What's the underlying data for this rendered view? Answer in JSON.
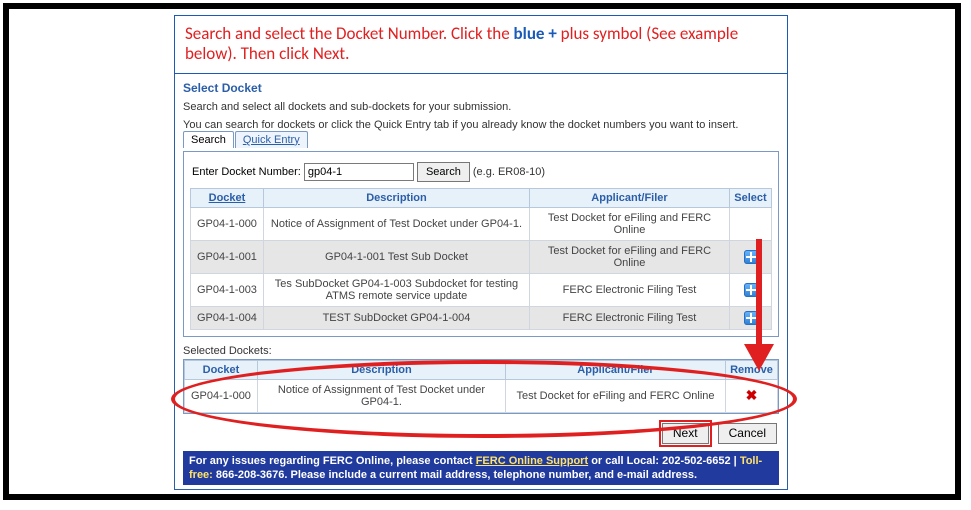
{
  "instruction": {
    "pre": "Search and select the Docket Number.  Click the ",
    "blue_text": "blue +",
    "post": " plus symbol (See example below). Then click Next."
  },
  "legend": "Select Docket",
  "desc": "Search and select all dockets and sub-dockets for your submission.",
  "desc2": "You can search for dockets or click the Quick Entry tab if you already know the docket numbers you want to insert.",
  "tabs": {
    "search": "Search",
    "quick": "Quick Entry"
  },
  "entry": {
    "label": "Enter Docket Number:",
    "value": "gp04-1",
    "search_btn": "Search",
    "eg": "(e.g. ER08-10)"
  },
  "results": {
    "headers": {
      "docket": "Docket",
      "description": "Description",
      "applicant": "Applicant/Filer",
      "select": "Select"
    },
    "rows": [
      {
        "docket": "GP04-1-000",
        "desc": "Notice of Assignment of Test Docket under GP04-1.",
        "applicant": "Test Docket for eFiling and FERC Online",
        "selectable": false
      },
      {
        "docket": "GP04-1-001",
        "desc": "GP04-1-001 Test Sub Docket",
        "applicant": "Test Docket for eFiling and FERC Online",
        "selectable": true
      },
      {
        "docket": "GP04-1-003",
        "desc": "Tes SubDocket GP04-1-003 Subdocket for testing ATMS remote service update",
        "applicant": "FERC Electronic Filing Test",
        "selectable": true
      },
      {
        "docket": "GP04-1-004",
        "desc": "TEST SubDocket GP04-1-004",
        "applicant": "FERC Electronic Filing Test",
        "selectable": true
      }
    ]
  },
  "selected_label": "Selected Dockets:",
  "selected": {
    "headers": {
      "docket": "Docket",
      "description": "Description",
      "applicant": "Applicant/Filer",
      "remove": "Remove"
    },
    "rows": [
      {
        "docket": "GP04-1-000",
        "desc": "Notice of Assignment of Test Docket under GP04-1.",
        "applicant": "Test Docket for eFiling and FERC Online"
      }
    ]
  },
  "nav": {
    "next": "Next",
    "cancel": "Cancel"
  },
  "footer": {
    "t1": "For any issues regarding FERC Online, please contact ",
    "link": "FERC Online Support",
    "t2": " or call Local: 202-502-6652 | ",
    "toll_label": "Toll-free:",
    "toll": " 866-208-3676.",
    "t3": " Please include a current mail address, telephone number, and e-mail address."
  }
}
